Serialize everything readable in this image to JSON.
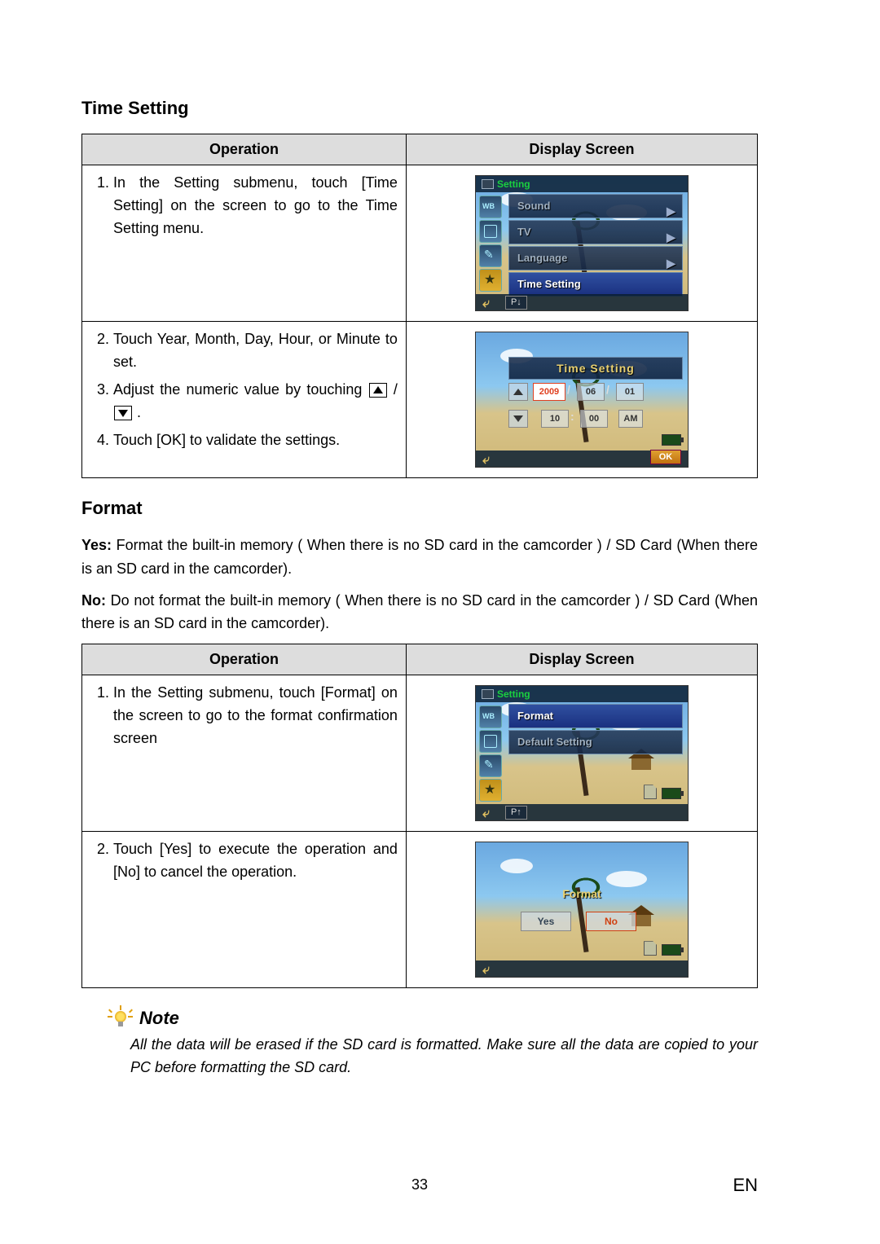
{
  "sections": {
    "time_setting": {
      "heading": "Time Setting",
      "table": {
        "headers": {
          "op": "Operation",
          "ds": "Display Screen"
        },
        "rows": [
          {
            "steps": [
              "In the Setting submenu, touch [Time Setting] on the screen to go to the Time Setting menu."
            ],
            "screen": {
              "title": "Setting",
              "menu": [
                {
                  "label": "Sound",
                  "selected": false,
                  "arrow": true
                },
                {
                  "label": "TV",
                  "selected": false,
                  "arrow": true
                },
                {
                  "label": "Language",
                  "selected": false,
                  "arrow": true
                },
                {
                  "label": "Time Setting",
                  "selected": true,
                  "arrow": false
                }
              ],
              "page_indicator": "P↓"
            }
          },
          {
            "steps_start": 2,
            "steps": [
              "Touch Year, Month, Day, Hour, or Minute to set.",
              "Adjust the numeric value by touching __UPDOWN__ .",
              "Touch [OK] to validate the settings."
            ],
            "screen": {
              "bar": "Time Setting",
              "date": {
                "year": "2009",
                "month": "06",
                "day": "01"
              },
              "time": {
                "hour": "10",
                "minute": "00",
                "ampm": "AM"
              },
              "ok": "OK"
            }
          }
        ]
      }
    },
    "format": {
      "heading": "Format",
      "intro": [
        {
          "bold": "Yes:",
          "text": " Format the built-in memory ( When there is no SD card in the camcorder ) / SD Card (When there is an SD card in the camcorder)."
        },
        {
          "bold": "No:",
          "text": " Do not format the built-in memory ( When there is no SD card in the camcorder ) / SD Card (When there is an SD card in the camcorder)."
        }
      ],
      "table": {
        "headers": {
          "op": "Operation",
          "ds": "Display Screen"
        },
        "rows": [
          {
            "steps": [
              "In the Setting submenu, touch [Format] on the screen to go to the format confirmation screen"
            ],
            "screen": {
              "title": "Setting",
              "menu": [
                {
                  "label": "Format",
                  "selected": true,
                  "arrow": false
                },
                {
                  "label": "Default Setting",
                  "selected": false,
                  "arrow": false
                }
              ],
              "page_indicator": "P↑"
            }
          },
          {
            "steps_start": 2,
            "steps": [
              "Touch [Yes] to execute the operation and [No] to cancel the operation."
            ],
            "screen": {
              "dialog_title": "Format",
              "yes": "Yes",
              "no": "No"
            }
          }
        ]
      }
    }
  },
  "note": {
    "heading": "Note",
    "text": "All the data will be erased if the SD card is formatted. Make sure all the data are copied to your PC before formatting the SD card."
  },
  "footer": {
    "page": "33",
    "lang": "EN"
  }
}
